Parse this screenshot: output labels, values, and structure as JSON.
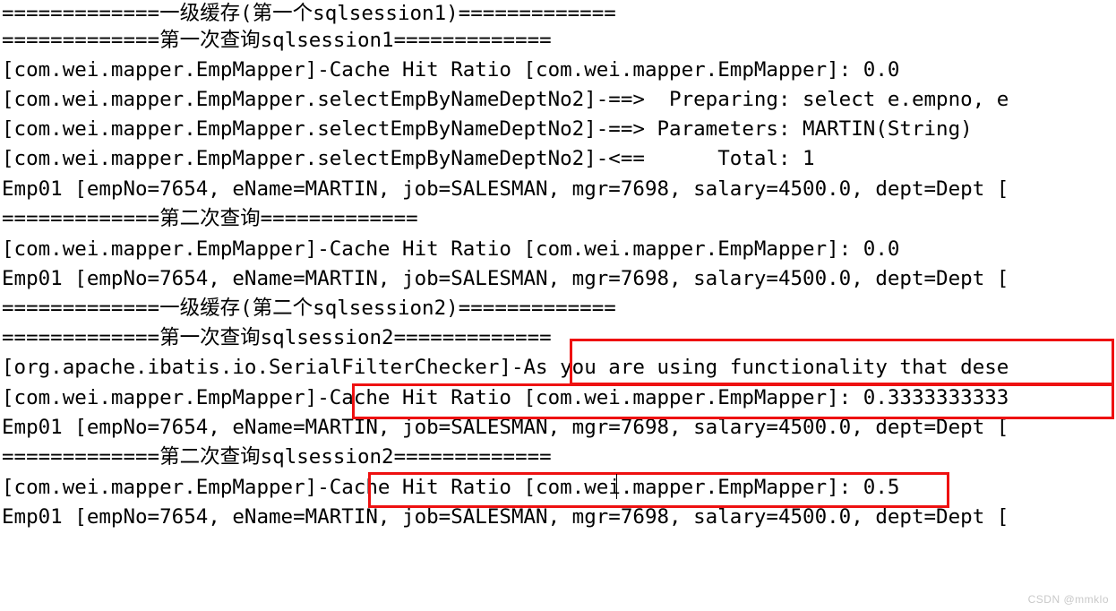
{
  "console": {
    "background_color": "#ffffff",
    "text_color": "#000000",
    "annotation_color": "#ee1111",
    "lines": [
      {
        "text": "=============一级缓存(第一个sqlsession1)============="
      },
      {
        "text": "=============第一次查询sqlsession1============="
      },
      {
        "text": "[com.wei.mapper.EmpMapper]-Cache Hit Ratio [com.wei.mapper.EmpMapper]: 0.0"
      },
      {
        "text": "[com.wei.mapper.EmpMapper.selectEmpByNameDeptNo2]-==>  Preparing: select e.empno, e"
      },
      {
        "text": "[com.wei.mapper.EmpMapper.selectEmpByNameDeptNo2]-==> Parameters: MARTIN(String)"
      },
      {
        "text": "[com.wei.mapper.EmpMapper.selectEmpByNameDeptNo2]-<==      Total: 1"
      },
      {
        "text": "Emp01 [empNo=7654, eName=MARTIN, job=SALESMAN, mgr=7698, salary=4500.0, dept=Dept ["
      },
      {
        "text": "=============第二次查询============="
      },
      {
        "text": "[com.wei.mapper.EmpMapper]-Cache Hit Ratio [com.wei.mapper.EmpMapper]: 0.0"
      },
      {
        "text": "Emp01 [empNo=7654, eName=MARTIN, job=SALESMAN, mgr=7698, salary=4500.0, dept=Dept ["
      },
      {
        "text": "=============一级缓存(第二个sqlsession2)============="
      },
      {
        "text": "=============第一次查询sqlsession2============="
      },
      {
        "text": "[org.apache.ibatis.io.SerialFilterChecker]-As you are using functionality that dese"
      },
      {
        "text": "[com.wei.mapper.EmpMapper]-Cache Hit Ratio [com.wei.mapper.EmpMapper]: 0.3333333333"
      },
      {
        "text": "Emp01 [empNo=7654, eName=MARTIN, job=SALESMAN, mgr=7698, salary=4500.0, dept=Dept ["
      },
      {
        "text": "=============第二次查询sqlsession2============="
      },
      {
        "text": "[com.wei.mapper.EmpMapper]-Cache Hit Ratio [com.wei.mapper.EmpMapper]: 0.5"
      },
      {
        "text": "Emp01 [empNo=7654, eName=MARTIN, job=SALESMAN, mgr=7698, salary=4500.0, dept=Dept ["
      }
    ],
    "annotations": [
      {
        "label": "highlight-serialfilterchecker-message"
      },
      {
        "label": "highlight-cache-hit-ratio-0.3333333333"
      },
      {
        "label": "highlight-cache-hit-ratio-0.5"
      }
    ]
  },
  "watermark": {
    "text": "CSDN @mmklo"
  }
}
